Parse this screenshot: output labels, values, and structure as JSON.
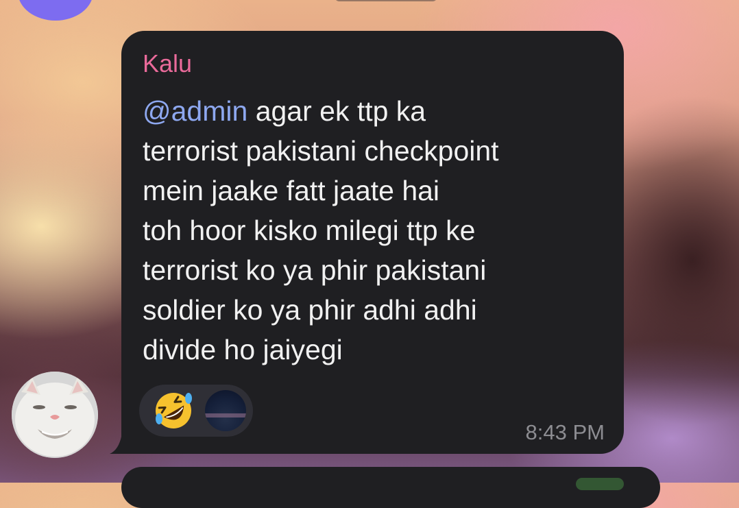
{
  "message": {
    "sender_name": "Kalu",
    "mention": "@admin",
    "lines": [
      " agar ek ttp ka",
      "terrorist pakistani checkpoint",
      "mein jaake fatt jaate hai",
      "toh hoor kisko milegi ttp ke",
      "terrorist ko ya phir pakistani",
      "soldier ko ya phir adhi adhi",
      "divide ho jaiyegi"
    ],
    "timestamp": "8:43 PM"
  },
  "reactions": [
    {
      "type": "emoji",
      "icon": "rolling-on-the-floor-laughing-icon"
    },
    {
      "type": "avatar",
      "icon": "reactor-avatar"
    }
  ],
  "colors": {
    "bubble_bg": "#1f1f22",
    "sender_name": "#e96a9a",
    "mention": "#8ea8f0",
    "message_text": "#f1f1f1",
    "timestamp": "#8d8d92",
    "reaction_pill": "#2f2f36"
  }
}
